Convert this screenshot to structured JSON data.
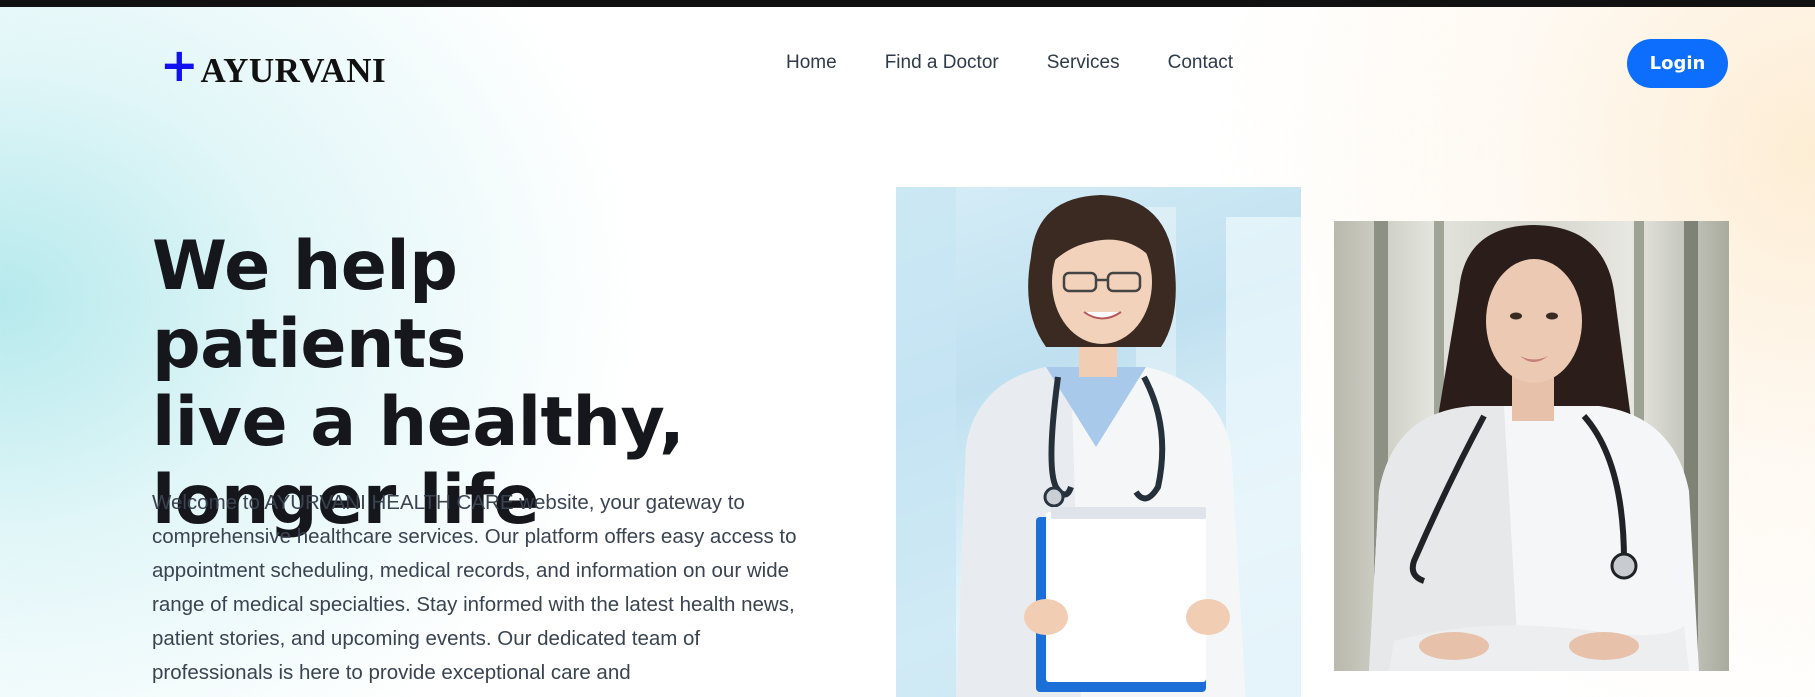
{
  "header": {
    "logo": {
      "plus_glyph": "+",
      "name": "AYURVANI",
      "plus_color": "#1010f0"
    },
    "nav": [
      {
        "label": "Home"
      },
      {
        "label": "Find a Doctor"
      },
      {
        "label": "Services"
      },
      {
        "label": "Contact"
      }
    ],
    "login_label": "Login",
    "accent_color": "#0d6efd"
  },
  "hero": {
    "title_lines": [
      "We help patients",
      "live a healthy,",
      "longer life"
    ],
    "description": "Welcome to AYURVANI HEALTH CARE website, your gateway to comprehensive healthcare services. Our platform offers easy access to appointment scheduling, medical records, and information on our wide range of medical specialties. Stay informed with the latest health news, patient stories, and upcoming events. Our dedicated team of professionals is here to provide exceptional care and"
  },
  "images": [
    {
      "name": "doctor-photo-glasses-holding-folders",
      "description": "female doctor with glasses, stethoscope, white coat, holding blue folders"
    },
    {
      "name": "doctor-photo-arms-crossed",
      "description": "female doctor with long dark hair, stethoscope, white coat, arms crossed"
    }
  ]
}
